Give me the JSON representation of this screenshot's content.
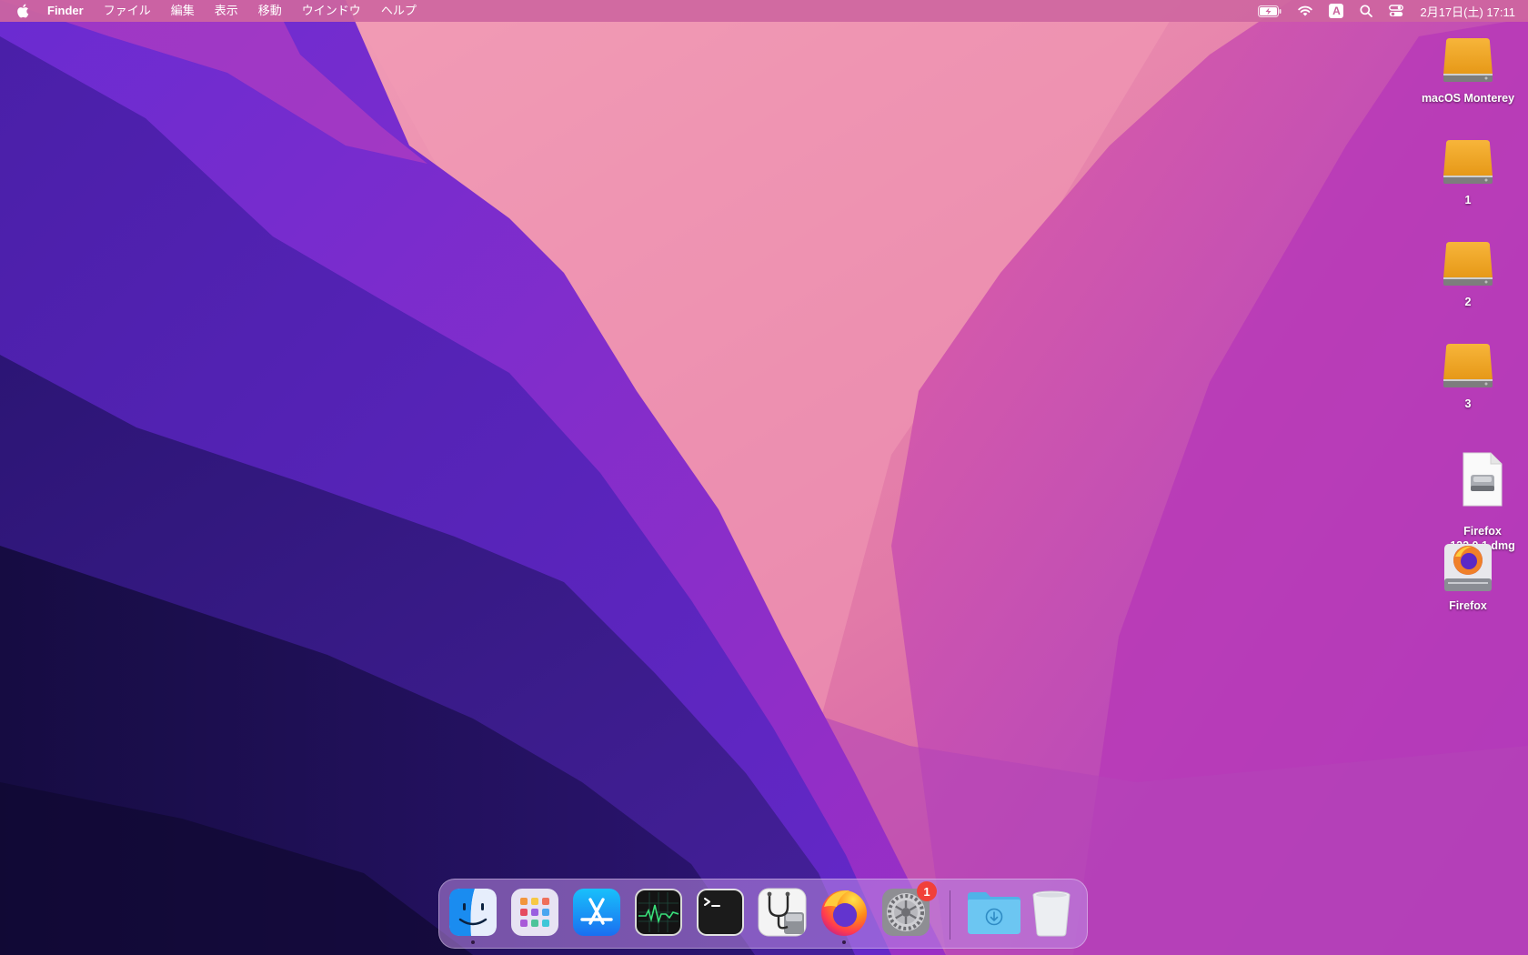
{
  "menubar": {
    "app_name": "Finder",
    "menus": [
      "ファイル",
      "編集",
      "表示",
      "移動",
      "ウインドウ",
      "ヘルプ"
    ],
    "input_mode": "A",
    "clock": "2月17日(土)  17:11"
  },
  "desktop": {
    "items": [
      {
        "label": "macOS Monterey",
        "icon": "hard-drive-icon"
      },
      {
        "label": "1",
        "icon": "hard-drive-icon"
      },
      {
        "label": "2",
        "icon": "hard-drive-icon"
      },
      {
        "label": "3",
        "icon": "hard-drive-icon"
      },
      {
        "label": "Firefox\n122.0.1.dmg",
        "icon": "disk-image-file-icon"
      },
      {
        "label": "Firefox",
        "icon": "mounted-volume-firefox-icon"
      }
    ]
  },
  "dock": {
    "apps": [
      {
        "name": "Finder",
        "icon": "finder-icon",
        "running": true
      },
      {
        "name": "Launchpad",
        "icon": "launchpad-icon",
        "running": false
      },
      {
        "name": "App Store",
        "icon": "app-store-icon",
        "running": false
      },
      {
        "name": "Activity Monitor",
        "icon": "activity-monitor-icon",
        "running": false
      },
      {
        "name": "Terminal",
        "icon": "terminal-icon",
        "running": false
      },
      {
        "name": "Disk Utility",
        "icon": "disk-utility-icon",
        "running": false
      },
      {
        "name": "Firefox",
        "icon": "firefox-icon",
        "running": true
      },
      {
        "name": "System Preferences",
        "icon": "system-preferences-icon",
        "running": false,
        "badge": "1"
      },
      {
        "name": "Downloads",
        "icon": "downloads-folder-icon"
      },
      {
        "name": "Trash",
        "icon": "trash-icon"
      }
    ]
  },
  "colors": {
    "menubar": "#ce66a0",
    "wallpaper_pink": "#f29bb5",
    "wallpaper_purple": "#5a22c4",
    "badge": "#f1403a"
  }
}
